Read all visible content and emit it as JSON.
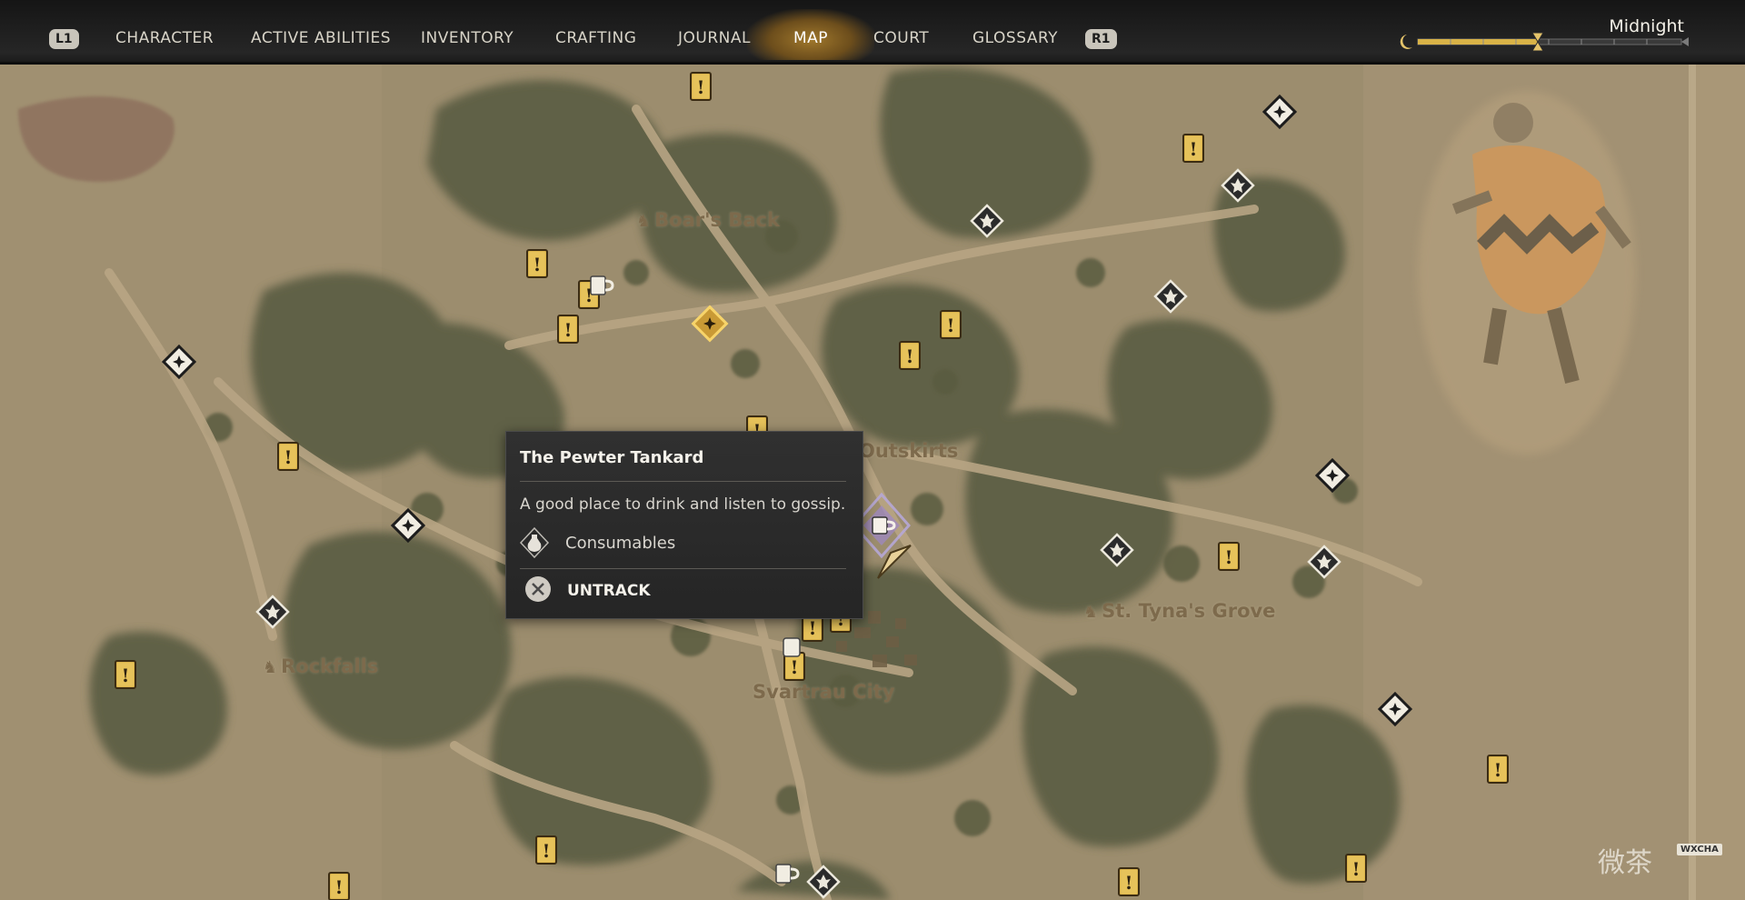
{
  "hud": {
    "left_bumper": "L1",
    "right_bumper": "R1",
    "tabs": [
      "CHARACTER",
      "ACTIVE ABILITIES",
      "INVENTORY",
      "CRAFTING",
      "JOURNAL",
      "MAP",
      "COURT",
      "GLOSSARY"
    ],
    "active_tab": "MAP",
    "time_of_day": "Midnight"
  },
  "tooltip": {
    "title": "The Pewter Tankard",
    "description": "A good place to drink and listen to gossip.",
    "category": "Consumables",
    "category_icon": "potion-icon",
    "action": "UNTRACK",
    "action_icon": "cross-button-icon"
  },
  "map": {
    "places": [
      "Boar's Back",
      "Rockfalls",
      "St. Tyna's Grove",
      "Svartrau City",
      "Outskirts"
    ],
    "colors": {
      "parchment": "#9c8d6e",
      "forest": "#5d5f44",
      "road": "#b8a584",
      "quest_marker": "#d9b24a",
      "waypoint": "#1d1d1d"
    }
  },
  "watermark": {
    "text": "微茶",
    "badge": "WXCHA"
  }
}
